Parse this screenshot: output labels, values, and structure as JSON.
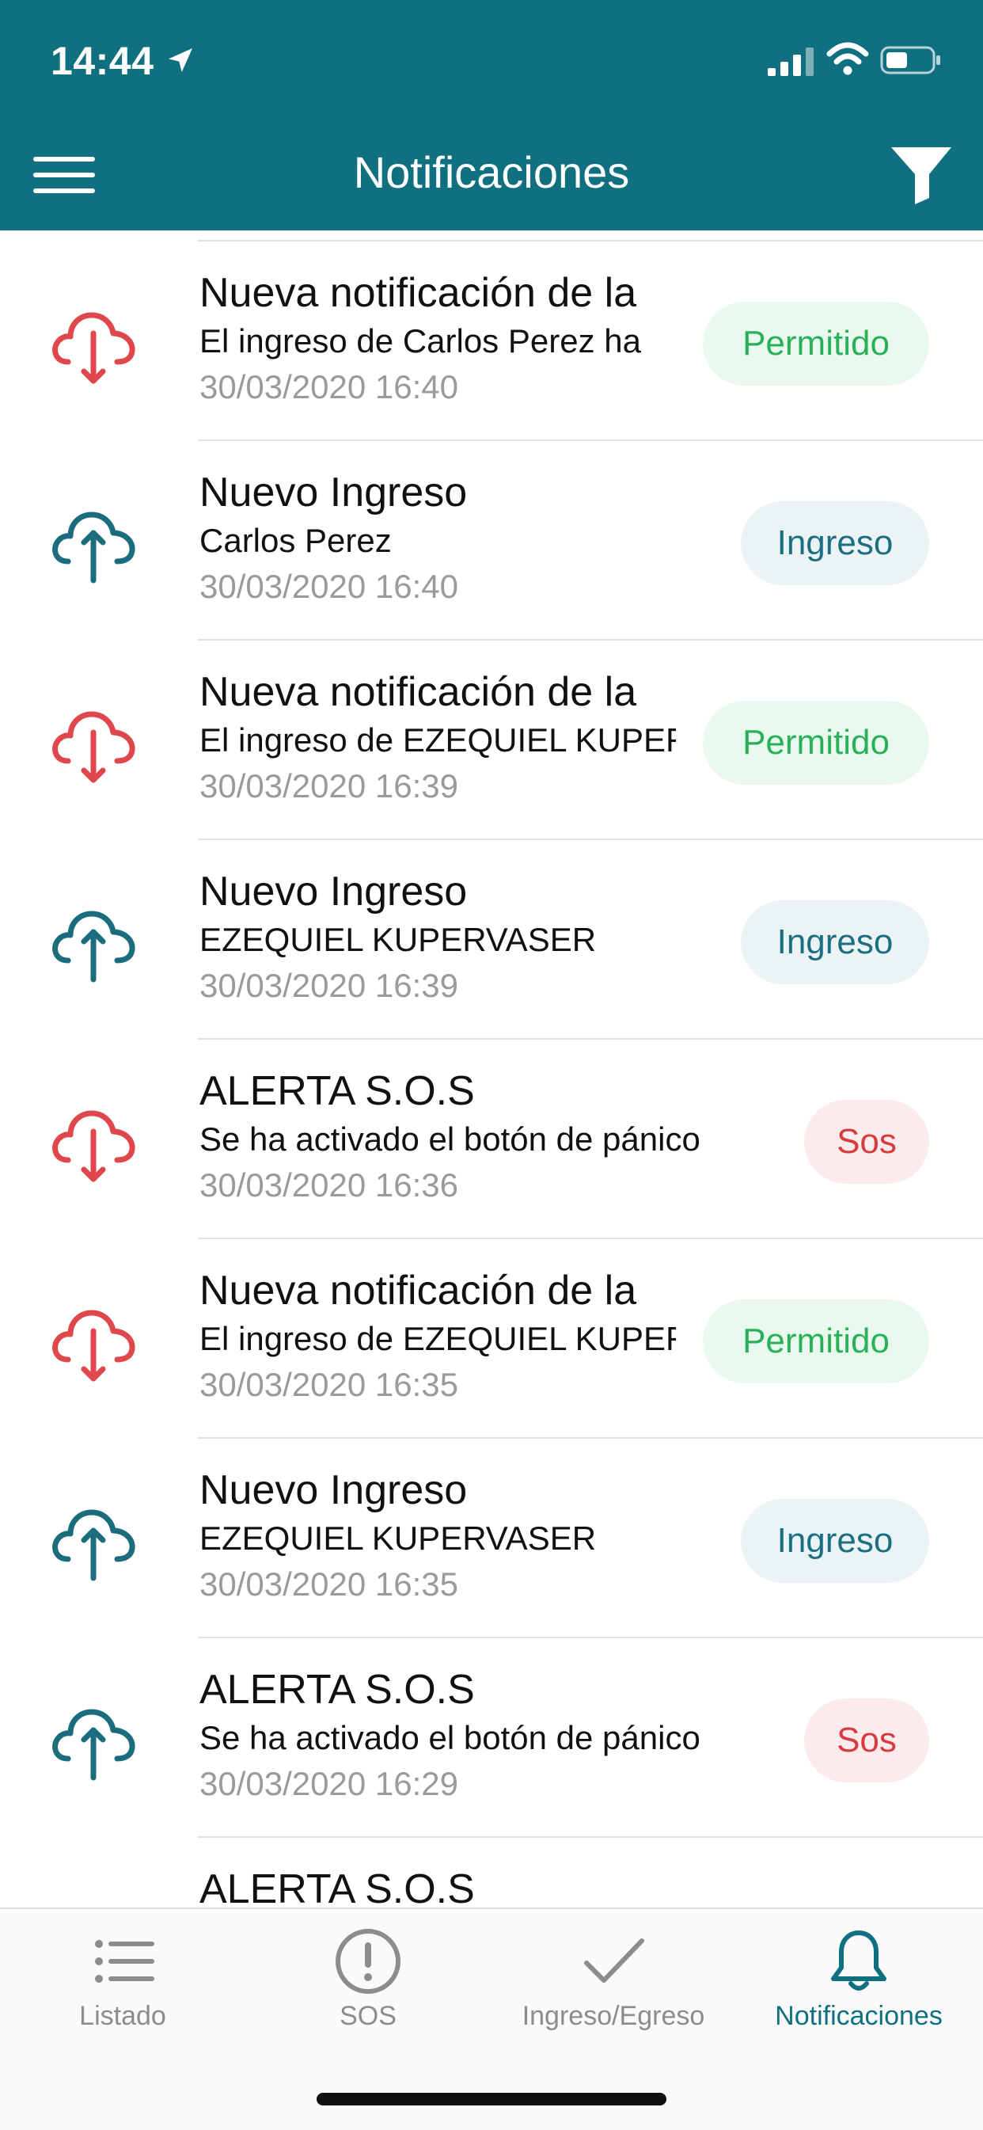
{
  "status": {
    "time": "14:44"
  },
  "header": {
    "title": "Notificaciones"
  },
  "notifications": [
    {
      "kind": "down",
      "title": "Nueva notificación de la",
      "subtitle": "El ingreso de Carlos Perez ha",
      "date": "30/03/2020 16:40",
      "badge": "Permitido",
      "badge_type": "perm"
    },
    {
      "kind": "up",
      "title": "Nuevo Ingreso",
      "subtitle": "Carlos Perez",
      "date": "30/03/2020 16:40",
      "badge": "Ingreso",
      "badge_type": "ing"
    },
    {
      "kind": "down",
      "title": "Nueva notificación de la",
      "subtitle": "El ingreso de EZEQUIEL KUPERVASER",
      "date": "30/03/2020 16:39",
      "badge": "Permitido",
      "badge_type": "perm"
    },
    {
      "kind": "up",
      "title": "Nuevo Ingreso",
      "subtitle": "EZEQUIEL KUPERVASER",
      "date": "30/03/2020 16:39",
      "badge": "Ingreso",
      "badge_type": "ing"
    },
    {
      "kind": "down",
      "title": "ALERTA S.O.S",
      "subtitle": "Se ha activado el botón de pánico",
      "date": "30/03/2020 16:36",
      "badge": "Sos",
      "badge_type": "sos"
    },
    {
      "kind": "down",
      "title": "Nueva notificación de la",
      "subtitle": "El ingreso de EZEQUIEL KUPERVASER",
      "date": "30/03/2020 16:35",
      "badge": "Permitido",
      "badge_type": "perm"
    },
    {
      "kind": "up",
      "title": "Nuevo Ingreso",
      "subtitle": "EZEQUIEL KUPERVASER",
      "date": "30/03/2020 16:35",
      "badge": "Ingreso",
      "badge_type": "ing"
    },
    {
      "kind": "up",
      "title": "ALERTA S.O.S",
      "subtitle": "Se ha activado el botón de pánico",
      "date": "30/03/2020 16:29",
      "badge": "Sos",
      "badge_type": "sos"
    },
    {
      "kind": "up",
      "title": "ALERTA S.O.S",
      "subtitle": "",
      "date": "",
      "badge": "",
      "badge_type": "sos"
    }
  ],
  "tabs": [
    {
      "label": "Listado",
      "icon": "list-icon",
      "active": false
    },
    {
      "label": "SOS",
      "icon": "alert-circle-icon",
      "active": false
    },
    {
      "label": "Ingreso/Egreso",
      "icon": "checkmark-icon",
      "active": false
    },
    {
      "label": "Notificaciones",
      "icon": "bell-icon",
      "active": true
    }
  ],
  "colors": {
    "header": "#10707f",
    "down_icon": "#e0474c",
    "up_icon": "#1b6d7e",
    "permitido_bg": "#e9f9ee",
    "permitido_text": "#2ab05a",
    "ingreso_bg": "#ecf3f5",
    "ingreso_text": "#1c6f80",
    "sos_bg": "#fcebec",
    "sos_text": "#d73b3e",
    "tab_active": "#10707f",
    "tab_inactive": "#8c8c8c"
  }
}
